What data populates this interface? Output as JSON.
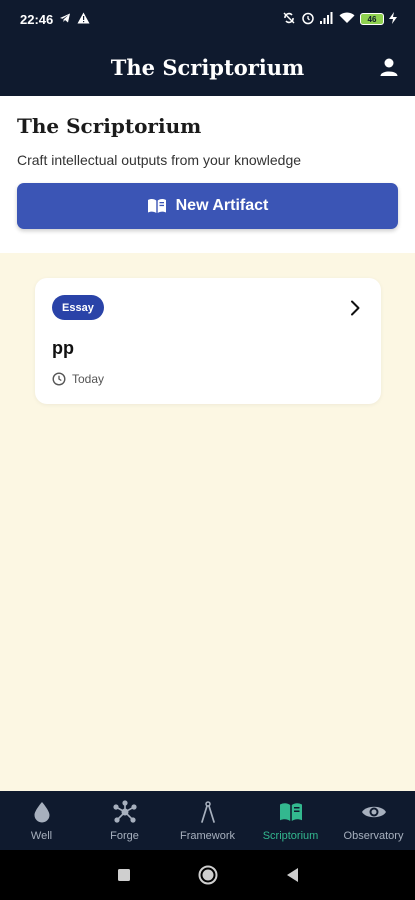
{
  "status_bar": {
    "time": "22:46",
    "battery": "46",
    "icons": [
      "telegram-icon",
      "warning-icon",
      "sync-icon",
      "alarm-icon",
      "signal-icon",
      "wifi-icon",
      "battery-icon",
      "charging-icon"
    ]
  },
  "app_bar": {
    "title": "The Scriptorium",
    "profile_icon": "person-icon"
  },
  "header": {
    "title": "The Scriptorium",
    "subtitle": "Craft intellectual outputs from your knowledge",
    "new_button_label": "New Artifact",
    "new_button_icon": "book-icon"
  },
  "artifacts": [
    {
      "type_badge": "Essay",
      "title": "pp",
      "date": "Today"
    }
  ],
  "bottom_nav": {
    "items": [
      {
        "label": "Well",
        "icon": "drop-icon"
      },
      {
        "label": "Forge",
        "icon": "network-icon"
      },
      {
        "label": "Framework",
        "icon": "compass-icon"
      },
      {
        "label": "Scriptorium",
        "icon": "book-icon",
        "active": true
      },
      {
        "label": "Observatory",
        "icon": "eye-icon"
      }
    ]
  },
  "colors": {
    "nav_background": "#0f1a2e",
    "accent_blue": "#3b55b5",
    "active_green": "#33b88f",
    "page_background": "#fcf7e3"
  }
}
